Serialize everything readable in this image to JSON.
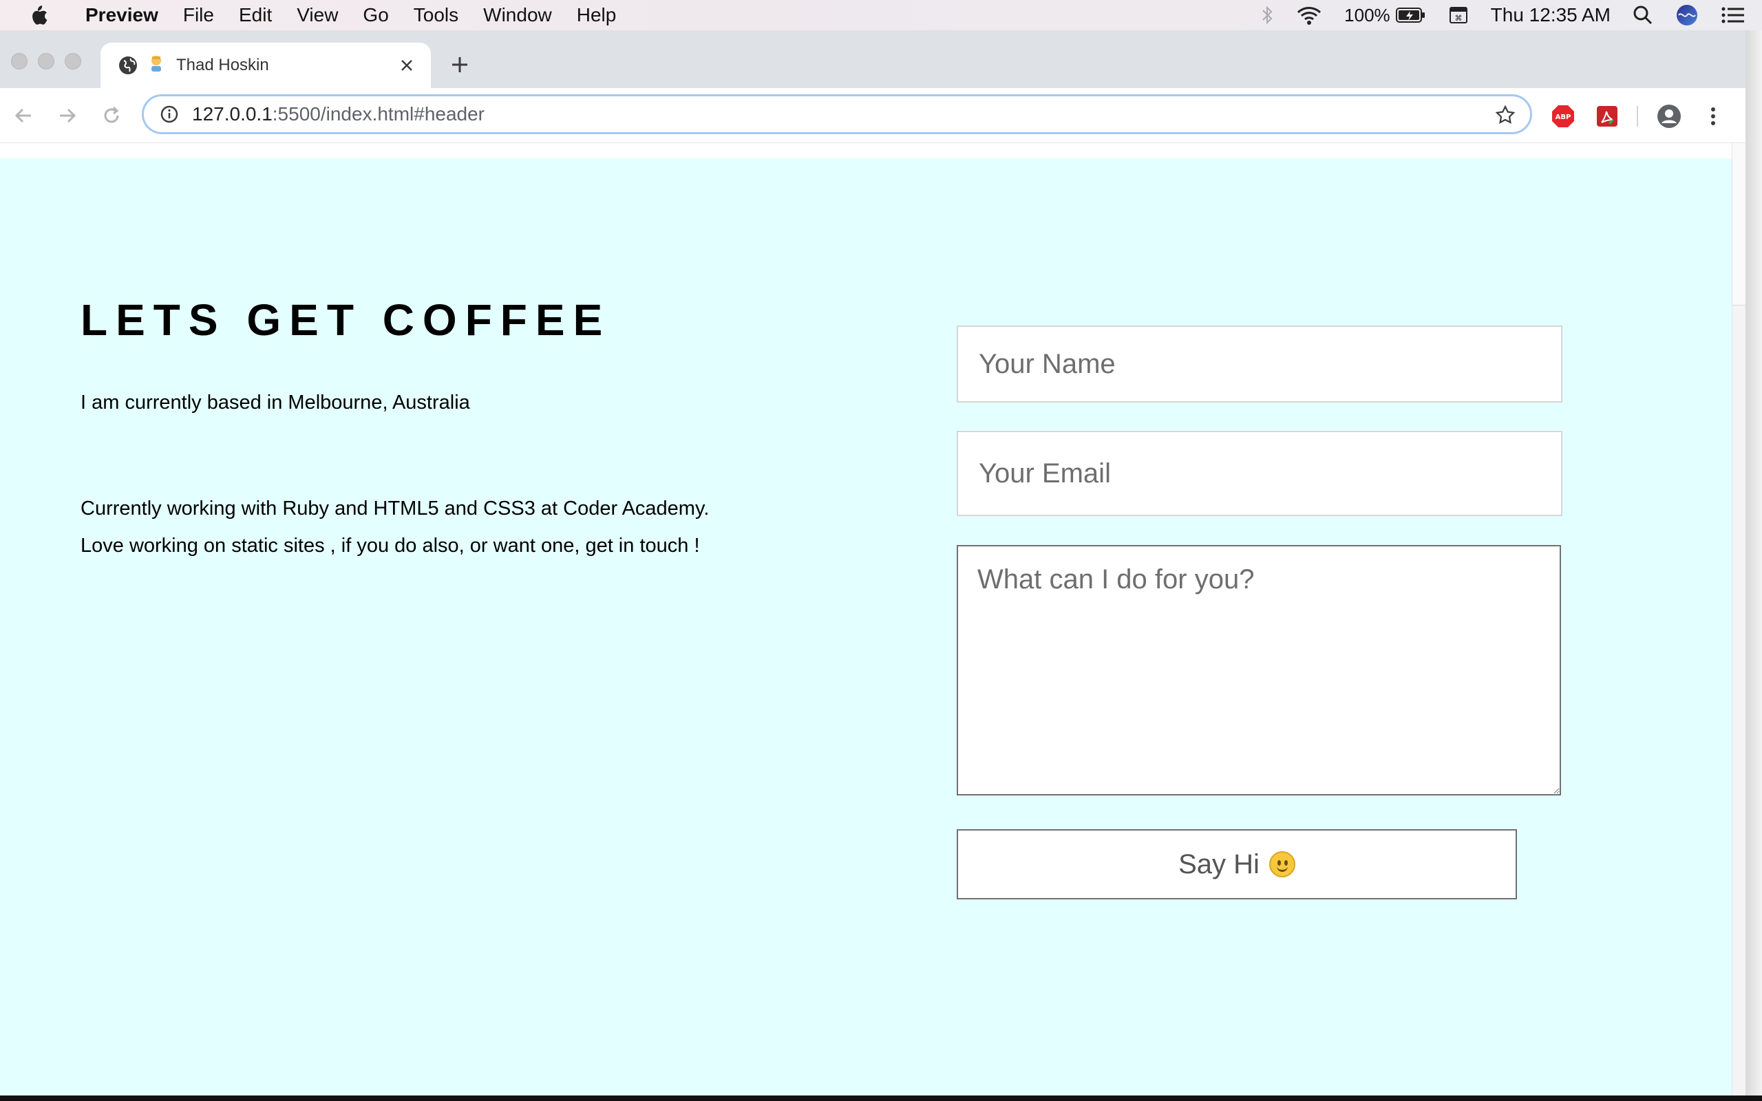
{
  "menubar": {
    "app_name": "Preview",
    "items": [
      "File",
      "Edit",
      "View",
      "Go",
      "Tools",
      "Window",
      "Help"
    ],
    "battery": "100%",
    "clock": "Thu 12:35 AM"
  },
  "browser": {
    "tab_title": "Thad Hoskin",
    "url_host": "127.0.0.1",
    "url_rest": ":5500/index.html#header",
    "extensions": [
      "adblock-plus-icon",
      "pdf-extension-icon"
    ]
  },
  "page": {
    "heading": "LETS GET COFFEE",
    "location_text": "I am currently based in Melbourne, Australia",
    "about_line_1": "Currently working with Ruby and HTML5 and CSS3 at Coder Academy.",
    "about_line_2": "Love working on static sites , if you do also, or want one, get in touch !",
    "background_color": "#e4ffff"
  },
  "form": {
    "name_placeholder": "Your Name",
    "email_placeholder": "Your Email",
    "message_placeholder": "What can I do for you?",
    "submit_label": "Say Hi"
  }
}
